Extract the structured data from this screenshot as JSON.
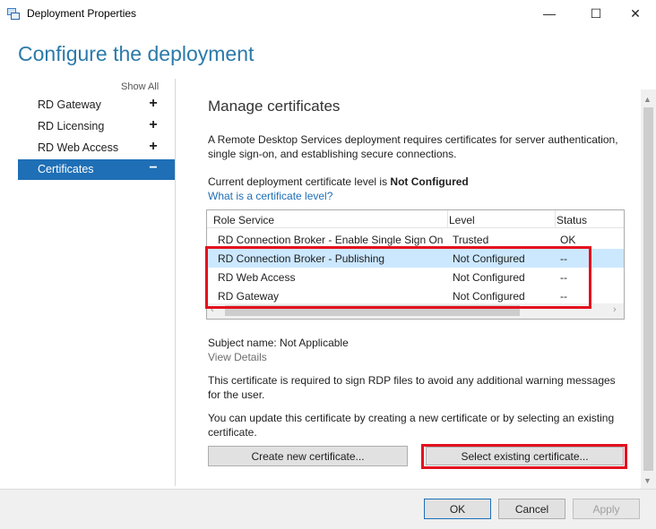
{
  "window": {
    "title": "Deployment Properties",
    "app_icon": "server-manager-icon",
    "minimize_icon": "—",
    "maximize_icon": "☐",
    "close_icon": "✕"
  },
  "page": {
    "title": "Configure the deployment"
  },
  "nav": {
    "show_all": "Show All",
    "items": [
      {
        "label": "RD Gateway",
        "sign": "+"
      },
      {
        "label": "RD Licensing",
        "sign": "+"
      },
      {
        "label": "RD Web Access",
        "sign": "+"
      },
      {
        "label": "Certificates",
        "sign": "−",
        "active": true
      }
    ]
  },
  "content": {
    "title": "Manage certificates",
    "intro_line1": "A Remote Desktop Services deployment requires certificates for server authentication,",
    "intro_line2": "single sign-on, and establishing secure connections.",
    "level_prefix": "Current deployment certificate level is ",
    "level_value": "Not Configured",
    "level_link": "What is a certificate level?",
    "table": {
      "columns": [
        "Role Service",
        "Level",
        "Status"
      ],
      "rows": [
        [
          "RD Connection Broker - Enable Single Sign On",
          "Trusted",
          "OK"
        ],
        [
          "RD Connection Broker - Publishing",
          "Not Configured",
          "--"
        ],
        [
          "RD Web Access",
          "Not Configured",
          "--"
        ],
        [
          "RD Gateway",
          "Not Configured",
          "--"
        ]
      ],
      "selected_row": 1
    },
    "subject_name": "Subject name: Not Applicable",
    "view_details": "View Details",
    "note1_line1": "This certificate is required to sign RDP files to avoid any additional warning messages",
    "note1_line2": "for the user.",
    "note2_line1": "You can update this certificate by creating a new certificate or by selecting an existing",
    "note2_line2": "certificate.",
    "create_button": "Create new certificate...",
    "select_button": "Select existing certificate..."
  },
  "footer": {
    "ok": "OK",
    "cancel": "Cancel",
    "apply": "Apply"
  },
  "colors": {
    "accent": "#1f6fb6",
    "title": "#2b7aa9",
    "highlight": "#e3101e",
    "selected_row": "#cce8ff"
  }
}
